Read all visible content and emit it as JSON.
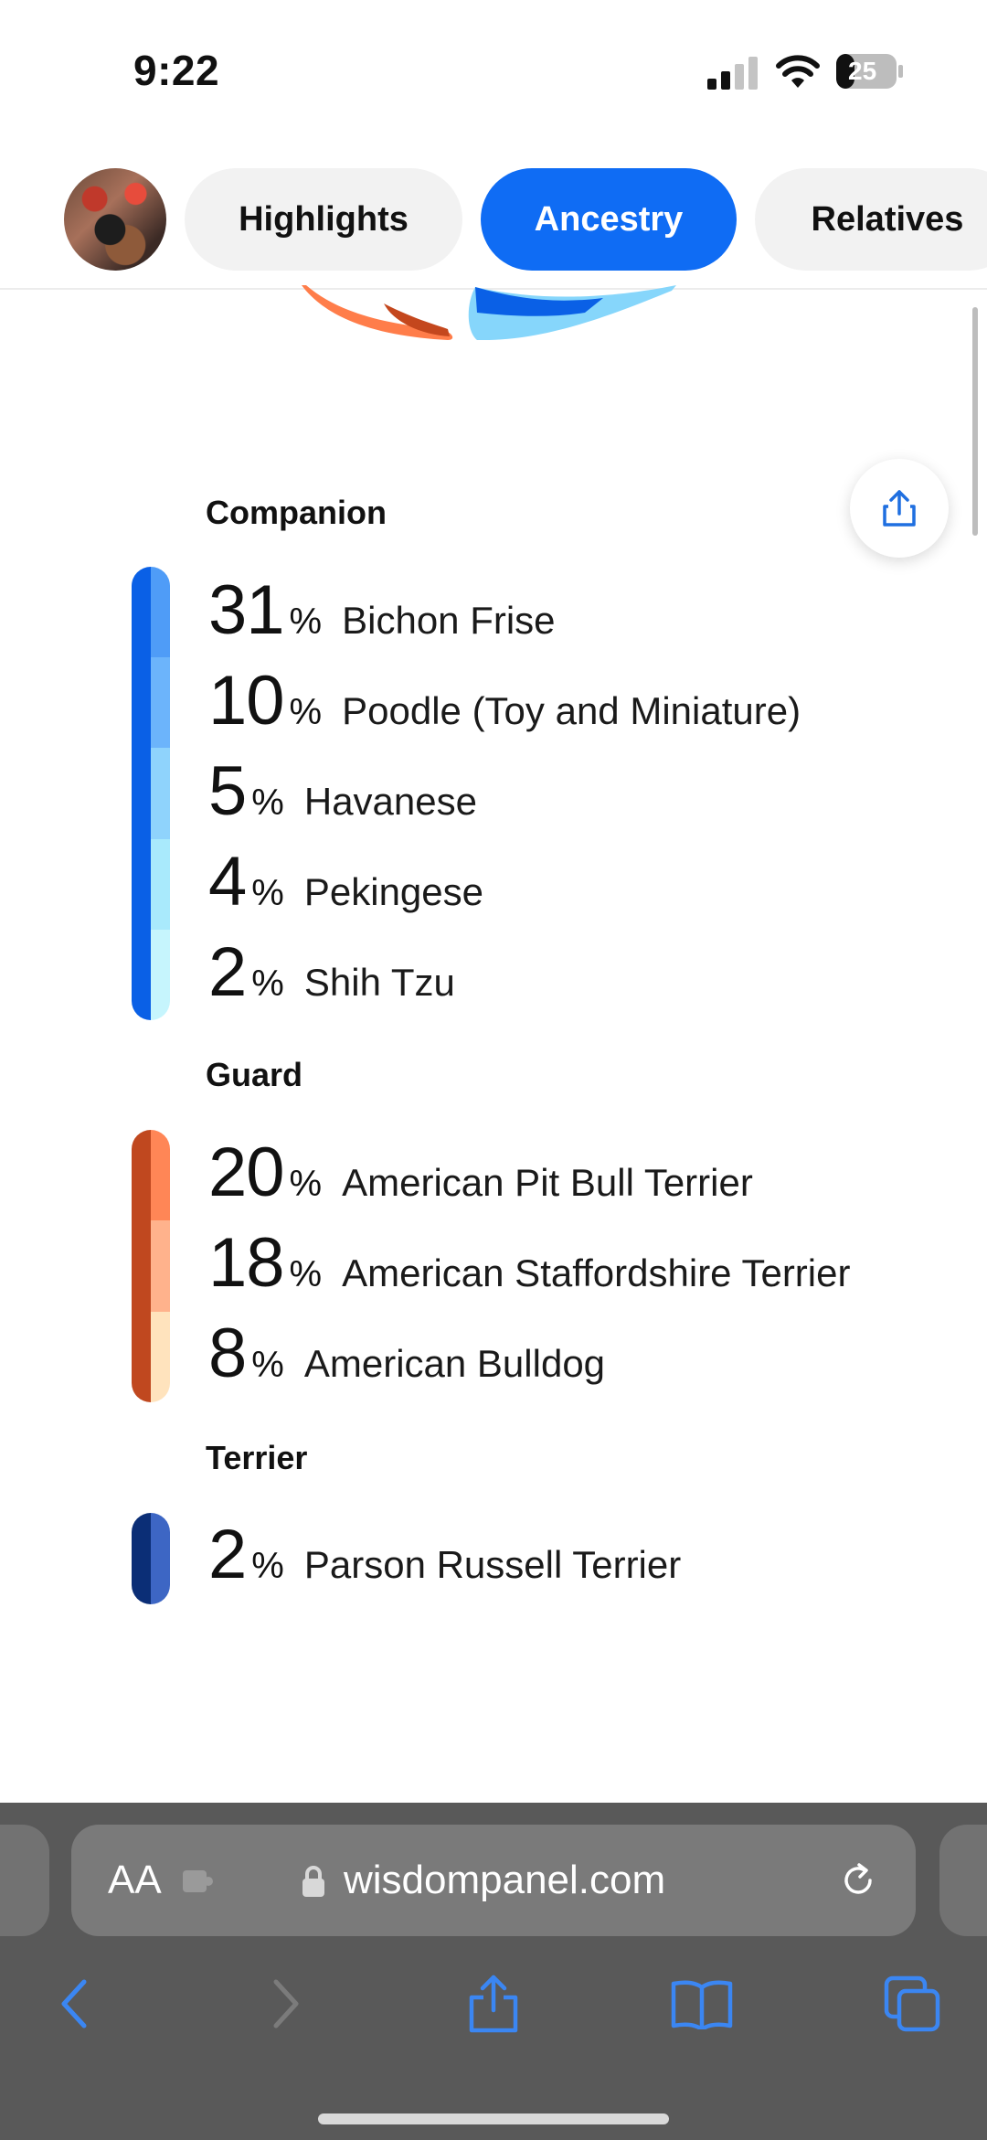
{
  "status": {
    "time": "9:22",
    "battery": "25"
  },
  "tabs": [
    {
      "label": "Highlights"
    },
    {
      "label": "Ancestry"
    },
    {
      "label": "Relatives"
    }
  ],
  "groups": [
    {
      "title": "Companion",
      "breeds": [
        {
          "pct": "31",
          "sign": "%",
          "name": "Bichon Frise"
        },
        {
          "pct": "10",
          "sign": "%",
          "name": "Poodle (Toy and Miniature)"
        },
        {
          "pct": "5",
          "sign": "%",
          "name": "Havanese"
        },
        {
          "pct": "4",
          "sign": "%",
          "name": "Pekingese"
        },
        {
          "pct": "2",
          "sign": "%",
          "name": "Shih Tzu"
        }
      ]
    },
    {
      "title": "Guard",
      "breeds": [
        {
          "pct": "20",
          "sign": "%",
          "name": "American Pit Bull Terrier"
        },
        {
          "pct": "18",
          "sign": "%",
          "name": "American Staffordshire Terrier"
        },
        {
          "pct": "8",
          "sign": "%",
          "name": "American Bulldog"
        }
      ]
    },
    {
      "title": "Terrier",
      "breeds": [
        {
          "pct": "2",
          "sign": "%",
          "name": "Parson Russell Terrier"
        }
      ]
    }
  ],
  "colors": {
    "accent": "#0f6cf4",
    "companion_inner": "#0a60e6",
    "companion_shades": [
      "#4f9cf7",
      "#6cb4fb",
      "#8fd3fc",
      "#a9eafc",
      "#c6f5fd"
    ],
    "guard_inner": "#c0481f",
    "guard_shades": [
      "#ff8656",
      "#ffb28c",
      "#ffe3bd"
    ],
    "terrier_inner": "#0b2e76",
    "terrier_shades": [
      "#3d66c4"
    ]
  },
  "browser": {
    "text_size_label": "AA",
    "url": "wisdompanel.com"
  }
}
